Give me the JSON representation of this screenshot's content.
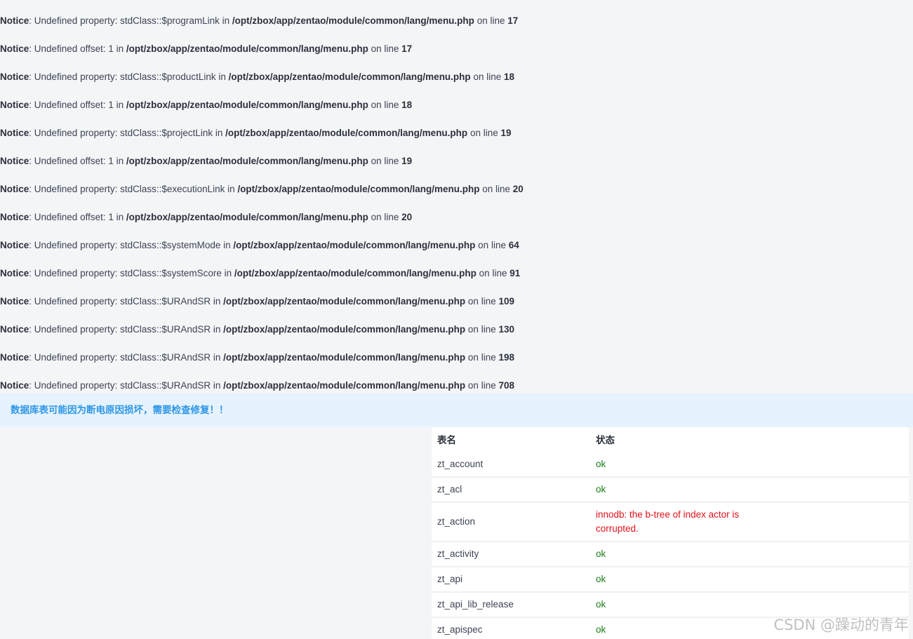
{
  "notices": [
    {
      "label": "Notice",
      "message": ": Undefined property: stdClass::$programLink in ",
      "file": "/opt/zbox/app/zentao/module/common/lang/menu.php",
      "online": " on line ",
      "line": "17"
    },
    {
      "label": "Notice",
      "message": ": Undefined offset: 1 in ",
      "file": "/opt/zbox/app/zentao/module/common/lang/menu.php",
      "online": " on line ",
      "line": "17"
    },
    {
      "label": "Notice",
      "message": ": Undefined property: stdClass::$productLink in ",
      "file": "/opt/zbox/app/zentao/module/common/lang/menu.php",
      "online": " on line ",
      "line": "18"
    },
    {
      "label": "Notice",
      "message": ": Undefined offset: 1 in ",
      "file": "/opt/zbox/app/zentao/module/common/lang/menu.php",
      "online": " on line ",
      "line": "18"
    },
    {
      "label": "Notice",
      "message": ": Undefined property: stdClass::$projectLink in ",
      "file": "/opt/zbox/app/zentao/module/common/lang/menu.php",
      "online": " on line ",
      "line": "19"
    },
    {
      "label": "Notice",
      "message": ": Undefined offset: 1 in ",
      "file": "/opt/zbox/app/zentao/module/common/lang/menu.php",
      "online": " on line ",
      "line": "19"
    },
    {
      "label": "Notice",
      "message": ": Undefined property: stdClass::$executionLink in ",
      "file": "/opt/zbox/app/zentao/module/common/lang/menu.php",
      "online": " on line ",
      "line": "20"
    },
    {
      "label": "Notice",
      "message": ": Undefined offset: 1 in ",
      "file": "/opt/zbox/app/zentao/module/common/lang/menu.php",
      "online": " on line ",
      "line": "20"
    },
    {
      "label": "Notice",
      "message": ": Undefined property: stdClass::$systemMode in ",
      "file": "/opt/zbox/app/zentao/module/common/lang/menu.php",
      "online": " on line ",
      "line": "64"
    },
    {
      "label": "Notice",
      "message": ": Undefined property: stdClass::$systemScore in ",
      "file": "/opt/zbox/app/zentao/module/common/lang/menu.php",
      "online": " on line ",
      "line": "91"
    },
    {
      "label": "Notice",
      "message": ": Undefined property: stdClass::$URAndSR in ",
      "file": "/opt/zbox/app/zentao/module/common/lang/menu.php",
      "online": " on line ",
      "line": "109"
    },
    {
      "label": "Notice",
      "message": ": Undefined property: stdClass::$URAndSR in ",
      "file": "/opt/zbox/app/zentao/module/common/lang/menu.php",
      "online": " on line ",
      "line": "130"
    },
    {
      "label": "Notice",
      "message": ": Undefined property: stdClass::$URAndSR in ",
      "file": "/opt/zbox/app/zentao/module/common/lang/menu.php",
      "online": " on line ",
      "line": "198"
    },
    {
      "label": "Notice",
      "message": ": Undefined property: stdClass::$URAndSR in ",
      "file": "/opt/zbox/app/zentao/module/common/lang/menu.php",
      "online": " on line ",
      "line": "708"
    }
  ],
  "alert": {
    "text": "数据库表可能因为断电原因损坏，需要检查修复！！",
    "color": "#2f97e6",
    "background": "#e6f3ff"
  },
  "table": {
    "headers": {
      "name": "表名",
      "status": "状态"
    },
    "rows": [
      {
        "name": "zt_account",
        "status": "ok",
        "state": "ok"
      },
      {
        "name": "zt_acl",
        "status": "ok",
        "state": "ok"
      },
      {
        "name": "zt_action",
        "status": "innodb: the b-tree of index actor is corrupted.",
        "state": "err"
      },
      {
        "name": "zt_activity",
        "status": "ok",
        "state": "ok"
      },
      {
        "name": "zt_api",
        "status": "ok",
        "state": "ok"
      },
      {
        "name": "zt_api_lib_release",
        "status": "ok",
        "state": "ok"
      },
      {
        "name": "zt_apispec",
        "status": "ok",
        "state": "ok"
      }
    ]
  },
  "colors": {
    "ok": "#1b7d1b",
    "error": "#e0101a",
    "page_background": "#f3f5f7"
  },
  "watermark": "CSDN @躁动的青年"
}
